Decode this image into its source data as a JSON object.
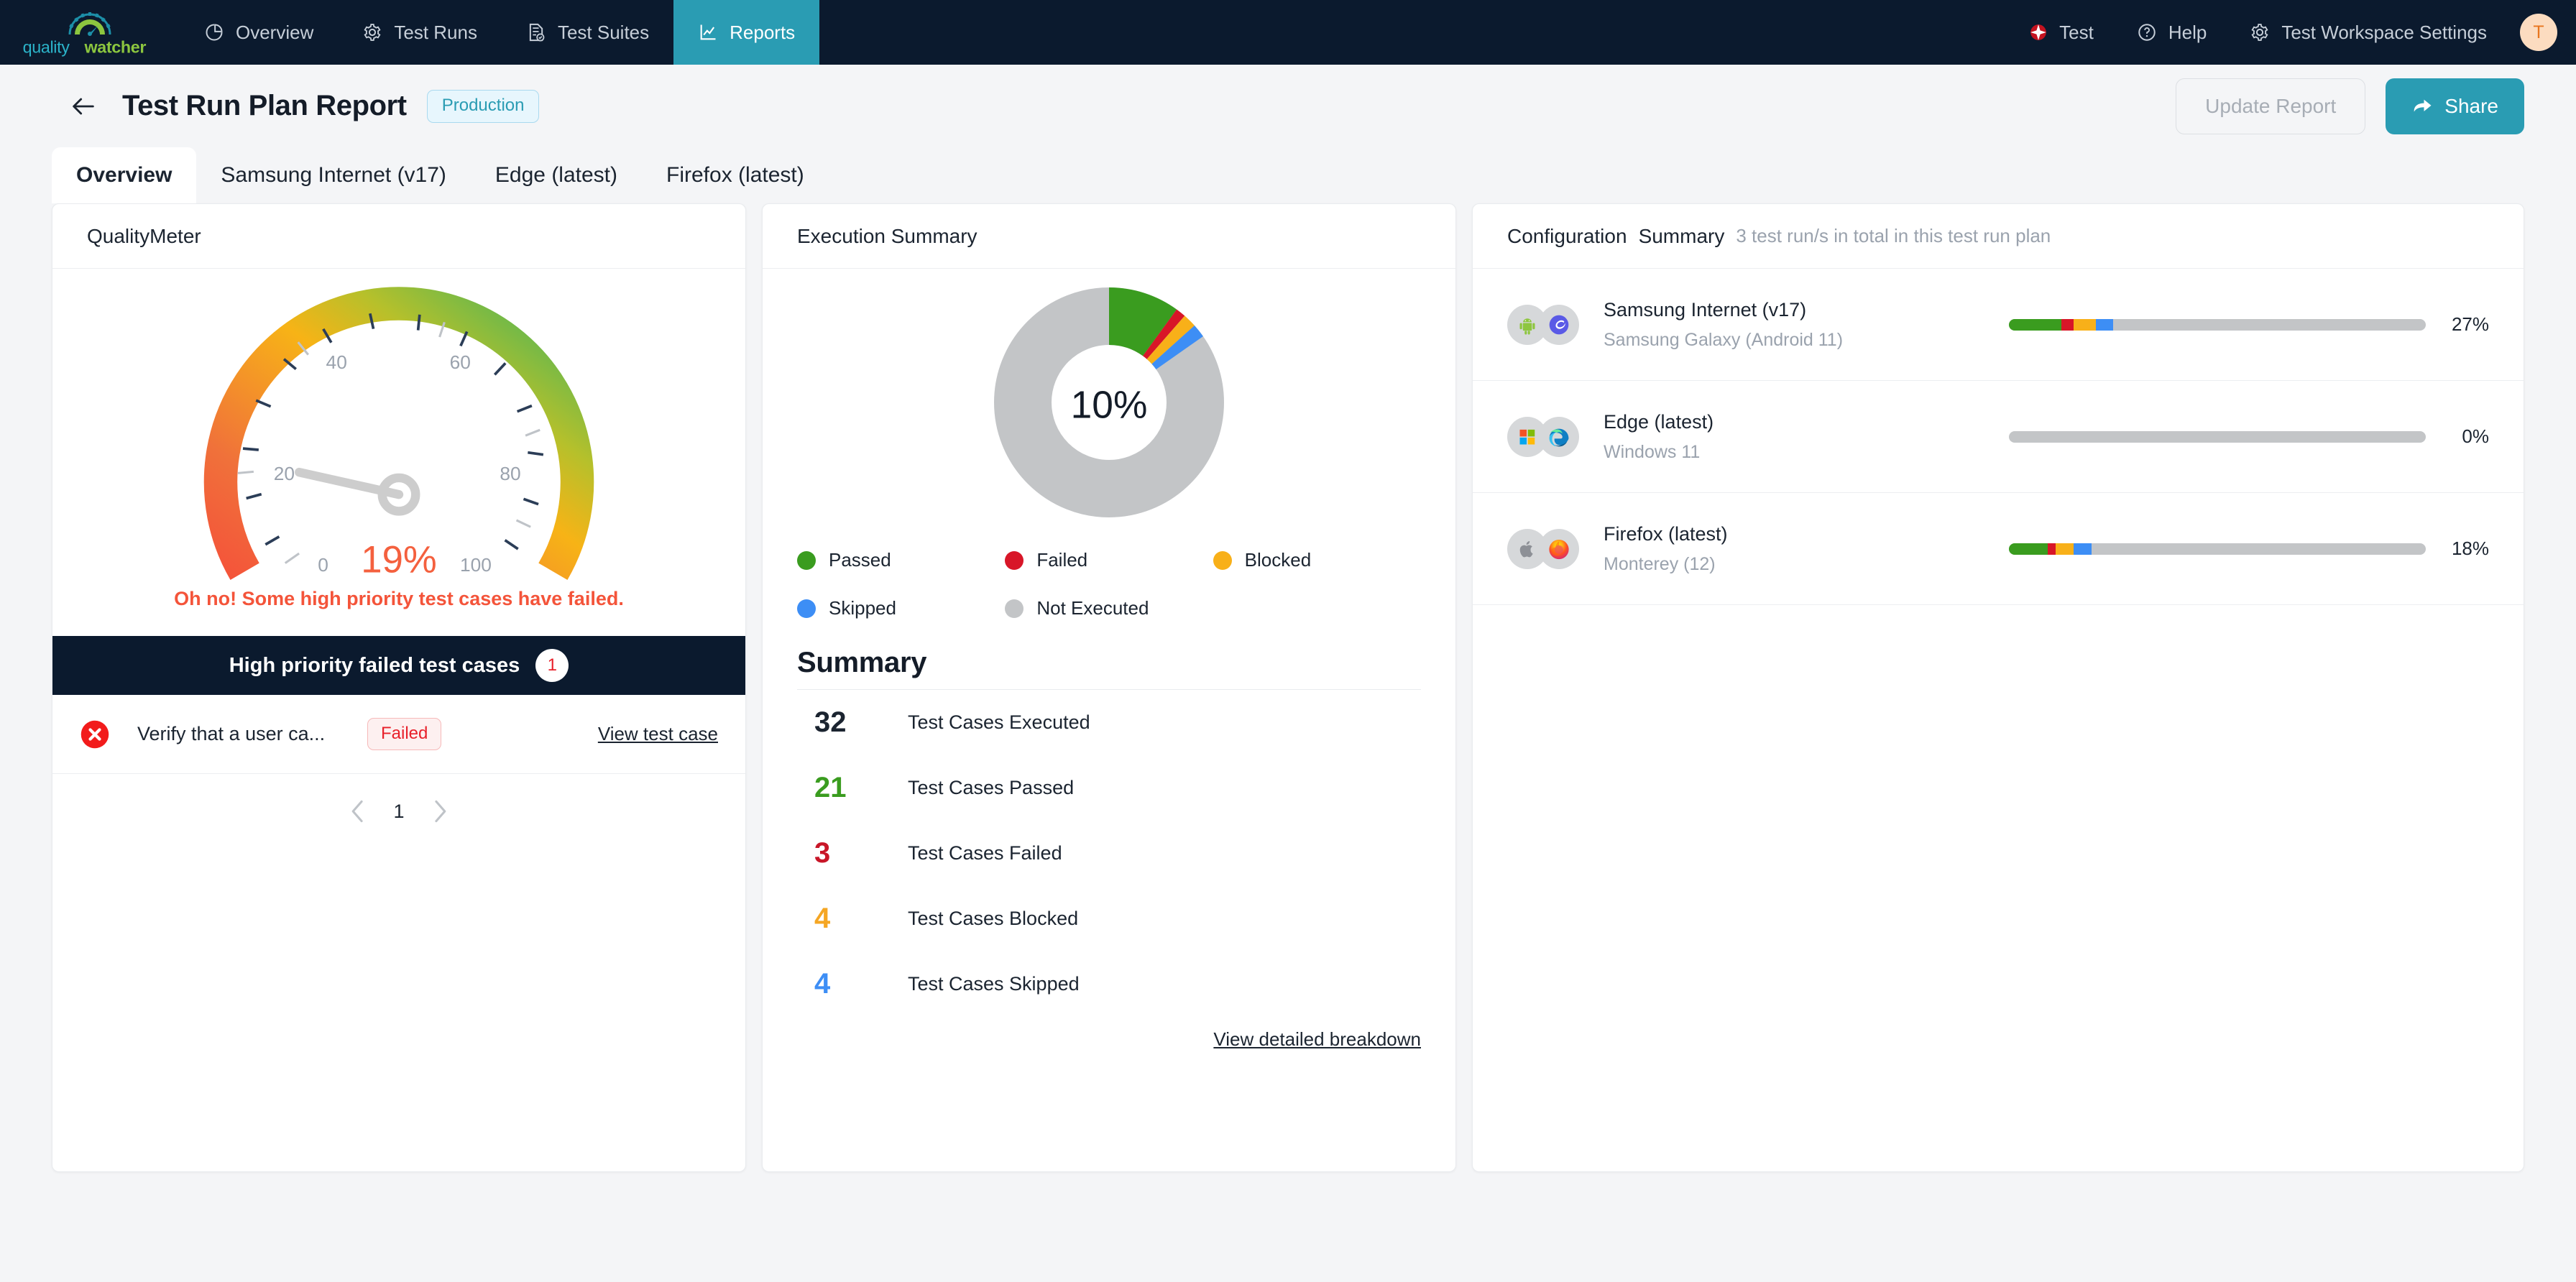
{
  "brand": {
    "name_part1": "quality",
    "name_part2": "watcher"
  },
  "topnav": {
    "items": [
      {
        "label": "Overview",
        "icon": "pie-chart-icon",
        "active": false
      },
      {
        "label": "Test Runs",
        "icon": "gear-icon",
        "active": false
      },
      {
        "label": "Test Suites",
        "icon": "document-check-icon",
        "active": false
      },
      {
        "label": "Reports",
        "icon": "line-chart-icon",
        "active": true
      }
    ],
    "right": [
      {
        "label": "Test",
        "icon": "pinwheel-icon"
      },
      {
        "label": "Help",
        "icon": "question-circle-icon"
      },
      {
        "label": "Test Workspace Settings",
        "icon": "gear-icon"
      }
    ],
    "avatar_initial": "T",
    "active_color": "#2a9cb3"
  },
  "header": {
    "back_icon": "arrow-left-icon",
    "title": "Test Run Plan Report",
    "environment_badge": "Production",
    "update_button": "Update Report",
    "share_button": "Share",
    "share_icon": "share-arrow-icon"
  },
  "tabs": [
    {
      "label": "Overview",
      "active": true
    },
    {
      "label": "Samsung Internet (v17)",
      "active": false
    },
    {
      "label": "Edge (latest)",
      "active": false
    },
    {
      "label": "Firefox (latest)",
      "active": false
    }
  ],
  "quality_meter": {
    "title": "QualityMeter",
    "message": "Oh no! Some high priority test cases have failed.",
    "high_priority_header": "High priority failed test cases",
    "high_priority_count": "1",
    "failed_cases": [
      {
        "name": "Verify that a user ca...",
        "status": "Failed",
        "link": "View test case",
        "icon": "x-circle-icon"
      }
    ],
    "pagination": {
      "page": "1",
      "prev_icon": "chevron-left-icon",
      "next_icon": "chevron-right-icon"
    }
  },
  "execution_summary": {
    "title": "Execution Summary",
    "center_label": "10%",
    "legend": [
      {
        "label": "Passed",
        "color": "#3a9c1f"
      },
      {
        "label": "Failed",
        "color": "#d81628"
      },
      {
        "label": "Blocked",
        "color": "#f8b019"
      },
      {
        "label": "Skipped",
        "color": "#3d8ef5"
      },
      {
        "label": "Not Executed",
        "color": "#c3c5c7"
      }
    ],
    "summary_title": "Summary",
    "rows": [
      {
        "value": "32",
        "label": "Test Cases Executed",
        "color": "#1b2430"
      },
      {
        "value": "21",
        "label": "Test Cases Passed",
        "color": "#3a9c1f"
      },
      {
        "value": "3",
        "label": "Test Cases Failed",
        "color": "#c81628"
      },
      {
        "value": "4",
        "label": "Test Cases Blocked",
        "color": "#f5a623"
      },
      {
        "value": "4",
        "label": "Test Cases Skipped",
        "color": "#3d8ef5"
      }
    ],
    "breakdown_link": "View detailed breakdown"
  },
  "configuration_summary": {
    "title_bold": "Configuration",
    "title_bold2": "Summary",
    "subtitle": "3 test run/s in total in this test run plan",
    "rows": [
      {
        "name": "Samsung Internet (v17)",
        "platform": "Samsung Galaxy (Android 11)",
        "percent": "27%",
        "os_icon": "android-icon",
        "browser_icon": "samsung-internet-icon",
        "segments": [
          {
            "status": "passed",
            "color": "#3a9c1f",
            "width": 12.5
          },
          {
            "status": "failed",
            "color": "#d81628",
            "width": 3.1
          },
          {
            "status": "blocked",
            "color": "#f8b019",
            "width": 5.2
          },
          {
            "status": "skipped",
            "color": "#3d8ef5",
            "width": 4.2
          }
        ]
      },
      {
        "name": "Edge (latest)",
        "platform": "Windows 11",
        "percent": "0%",
        "os_icon": "windows-icon",
        "browser_icon": "edge-icon",
        "segments": []
      },
      {
        "name": "Firefox (latest)",
        "platform": "Monterey (12)",
        "percent": "18%",
        "os_icon": "apple-icon",
        "browser_icon": "firefox-icon",
        "segments": [
          {
            "status": "passed",
            "color": "#3a9c1f",
            "width": 9.3
          },
          {
            "status": "failed",
            "color": "#d81628",
            "width": 1.9
          },
          {
            "status": "blocked",
            "color": "#f8b019",
            "width": 4.3
          },
          {
            "status": "skipped",
            "color": "#3d8ef5",
            "width": 4.3
          }
        ]
      }
    ]
  },
  "chart_data": [
    {
      "type": "gauge",
      "title": "QualityMeter",
      "value": 19,
      "value_label": "19%",
      "min": 0,
      "max": 100,
      "tick_labels": [
        "0",
        "20",
        "40",
        "60",
        "80",
        "100"
      ],
      "tick_values": [
        0,
        20,
        40,
        60,
        80,
        100
      ],
      "colors": [
        "#f4543a",
        "#f08634",
        "#f8b019",
        "#a8bf2e",
        "#45b55e"
      ],
      "annotation": "Oh no! Some high priority test cases have failed."
    },
    {
      "type": "pie",
      "title": "Execution Summary",
      "center_label": "10%",
      "categories": [
        "Passed",
        "Failed",
        "Blocked",
        "Skipped",
        "Not Executed"
      ],
      "values": [
        21,
        3,
        4,
        4,
        178
      ],
      "colors": [
        "#3a9c1f",
        "#d81628",
        "#f8b019",
        "#3d8ef5",
        "#c3c5c7"
      ],
      "legend": "bottom",
      "donut": true
    },
    {
      "type": "bar",
      "title": "Configuration Summary",
      "orientation": "horizontal-stacked",
      "categories": [
        "Samsung Internet (v17)",
        "Edge (latest)",
        "Firefox (latest)"
      ],
      "series": [
        {
          "name": "Passed",
          "values": [
            12.5,
            0,
            9.3
          ],
          "color": "#3a9c1f"
        },
        {
          "name": "Failed",
          "values": [
            3.1,
            0,
            1.9
          ],
          "color": "#d81628"
        },
        {
          "name": "Blocked",
          "values": [
            5.2,
            0,
            4.3
          ],
          "color": "#f8b019"
        },
        {
          "name": "Skipped",
          "values": [
            4.2,
            0,
            4.3
          ],
          "color": "#3d8ef5"
        }
      ],
      "totals_label": [
        "27%",
        "0%",
        "18%"
      ],
      "xlim": [
        0,
        100
      ],
      "ylabel": "",
      "xlabel": ""
    }
  ]
}
